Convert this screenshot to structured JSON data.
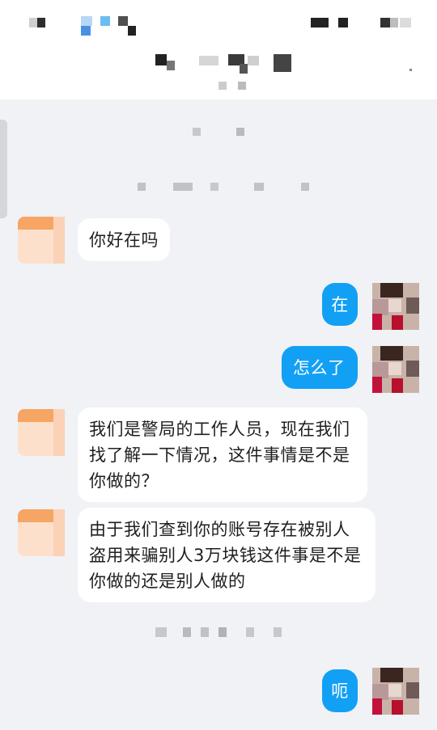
{
  "messages": [
    {
      "side": "left",
      "text": "你好在吗"
    },
    {
      "side": "right",
      "text": "在"
    },
    {
      "side": "right",
      "text": "怎么了"
    },
    {
      "side": "left",
      "text": "我们是警局的工作人员，现在我们找了解一下情况，这件事情是不是你做的？"
    },
    {
      "side": "left",
      "text": "由于我们查到你的账号存在被别人盗用来骗别人3万块钱这件事是不是你做的还是别人做的"
    },
    {
      "side": "right",
      "text": "呃"
    }
  ],
  "colors": {
    "background": "#f0f2f5",
    "outgoing_bubble": "#12a0f5",
    "incoming_bubble": "#ffffff"
  }
}
